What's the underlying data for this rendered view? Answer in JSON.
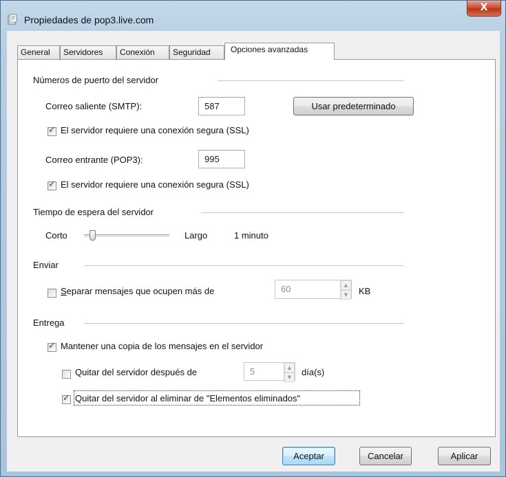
{
  "window": {
    "title": "Propiedades de pop3.live.com",
    "close_label": "X"
  },
  "tabs": [
    {
      "label": "General"
    },
    {
      "label": "Servidores"
    },
    {
      "label": "Conexión"
    },
    {
      "label": "Seguridad"
    },
    {
      "label": "Opciones avanzadas",
      "active": true
    }
  ],
  "ports": {
    "group_label": "Números de puerto del servidor",
    "smtp_label": "Correo saliente (SMTP):",
    "smtp_value": "587",
    "use_default_label": "Usar predeterminado",
    "smtp_ssl_label": "El servidor requiere una conexión segura (SSL)",
    "smtp_ssl_checked": true,
    "pop3_label": "Correo entrante (POP3):",
    "pop3_value": "995",
    "pop3_ssl_label": "El servidor requiere una conexión segura (SSL)",
    "pop3_ssl_checked": true
  },
  "timeout": {
    "group_label": "Tiempo de espera del servidor",
    "short_label": "Corto",
    "long_label": "Largo",
    "value_label": "1 minuto",
    "slider_position": 0.1
  },
  "send": {
    "group_label": "Enviar",
    "split_label": "Separar mensajes que ocupen más de",
    "split_checked": false,
    "split_value": "60",
    "unit": "KB"
  },
  "delivery": {
    "group_label": "Entrega",
    "keep_copy_label": "Mantener una copia de los mensajes en el servidor",
    "keep_copy_checked": true,
    "remove_after_label": "Quitar del servidor después de",
    "remove_after_checked": false,
    "remove_after_value": "5",
    "days_unit": "día(s)",
    "remove_on_delete_label": "Quitar del servidor al eliminar de \"Elementos eliminados\"",
    "remove_on_delete_checked": true
  },
  "buttons": {
    "ok": "Aceptar",
    "cancel": "Cancelar",
    "apply": "Aplicar"
  }
}
